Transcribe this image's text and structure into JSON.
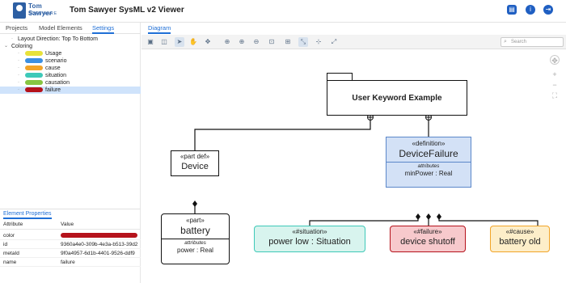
{
  "header": {
    "logo_text": "Tom Sawyer",
    "logo_sub": "SOFTWARE",
    "title": "Tom Sawyer SysML v2 Viewer",
    "buttons": [
      "document-icon",
      "info-icon",
      "logout-icon"
    ]
  },
  "left_tabs": [
    "Projects",
    "Model Elements",
    "Settings"
  ],
  "settings_tree": {
    "layout": "Layout Direction: Top To Bottom",
    "coloring": "Coloring",
    "items": [
      {
        "label": "Usage",
        "color": "#e8e23a"
      },
      {
        "label": "scenario",
        "color": "#3b8fe2"
      },
      {
        "label": "cause",
        "color": "#f2a428"
      },
      {
        "label": "situation",
        "color": "#3ec9b8"
      },
      {
        "label": "causation",
        "color": "#86c542"
      },
      {
        "label": "failure",
        "color": "#b5121b"
      }
    ]
  },
  "properties": {
    "tab": "Element Properties",
    "headers": [
      "Attribute",
      "Value"
    ],
    "rows": [
      {
        "attr": "color",
        "value": ""
      },
      {
        "attr": "id",
        "value": "9360a4e0-309b-4e3a-b513-39d2"
      },
      {
        "attr": "metaId",
        "value": "9f0a4957-6d1b-4401-9526-ddf9"
      },
      {
        "attr": "name",
        "value": "failure"
      }
    ],
    "color_value": "#b5121b"
  },
  "diagram": {
    "tab": "Diagram",
    "search_placeholder": "Search",
    "top": {
      "name": "User Keyword Example"
    },
    "partdef": {
      "stereo": "«part def»",
      "name": "Device"
    },
    "definition": {
      "stereo": "«definition»",
      "name": "DeviceFailure",
      "attr_label": "attributes",
      "attr": "minPower : Real",
      "color": "#d3e1f6",
      "border": "#5b87c9"
    },
    "part": {
      "stereo": "«part»",
      "name": "battery",
      "attr_label": "attributes",
      "attr": "power : Real"
    },
    "situation": {
      "stereo": "«#situation»",
      "name": "power low : Situation",
      "color": "#d8f4ee",
      "border": "#3ec9b8"
    },
    "failure": {
      "stereo": "«#failure»",
      "name": "device shutoff",
      "color": "#f7c9cc",
      "border": "#b5121b"
    },
    "cause": {
      "stereo": "«#cause»",
      "name": "battery old",
      "color": "#fdeec9",
      "border": "#f2a428"
    }
  }
}
